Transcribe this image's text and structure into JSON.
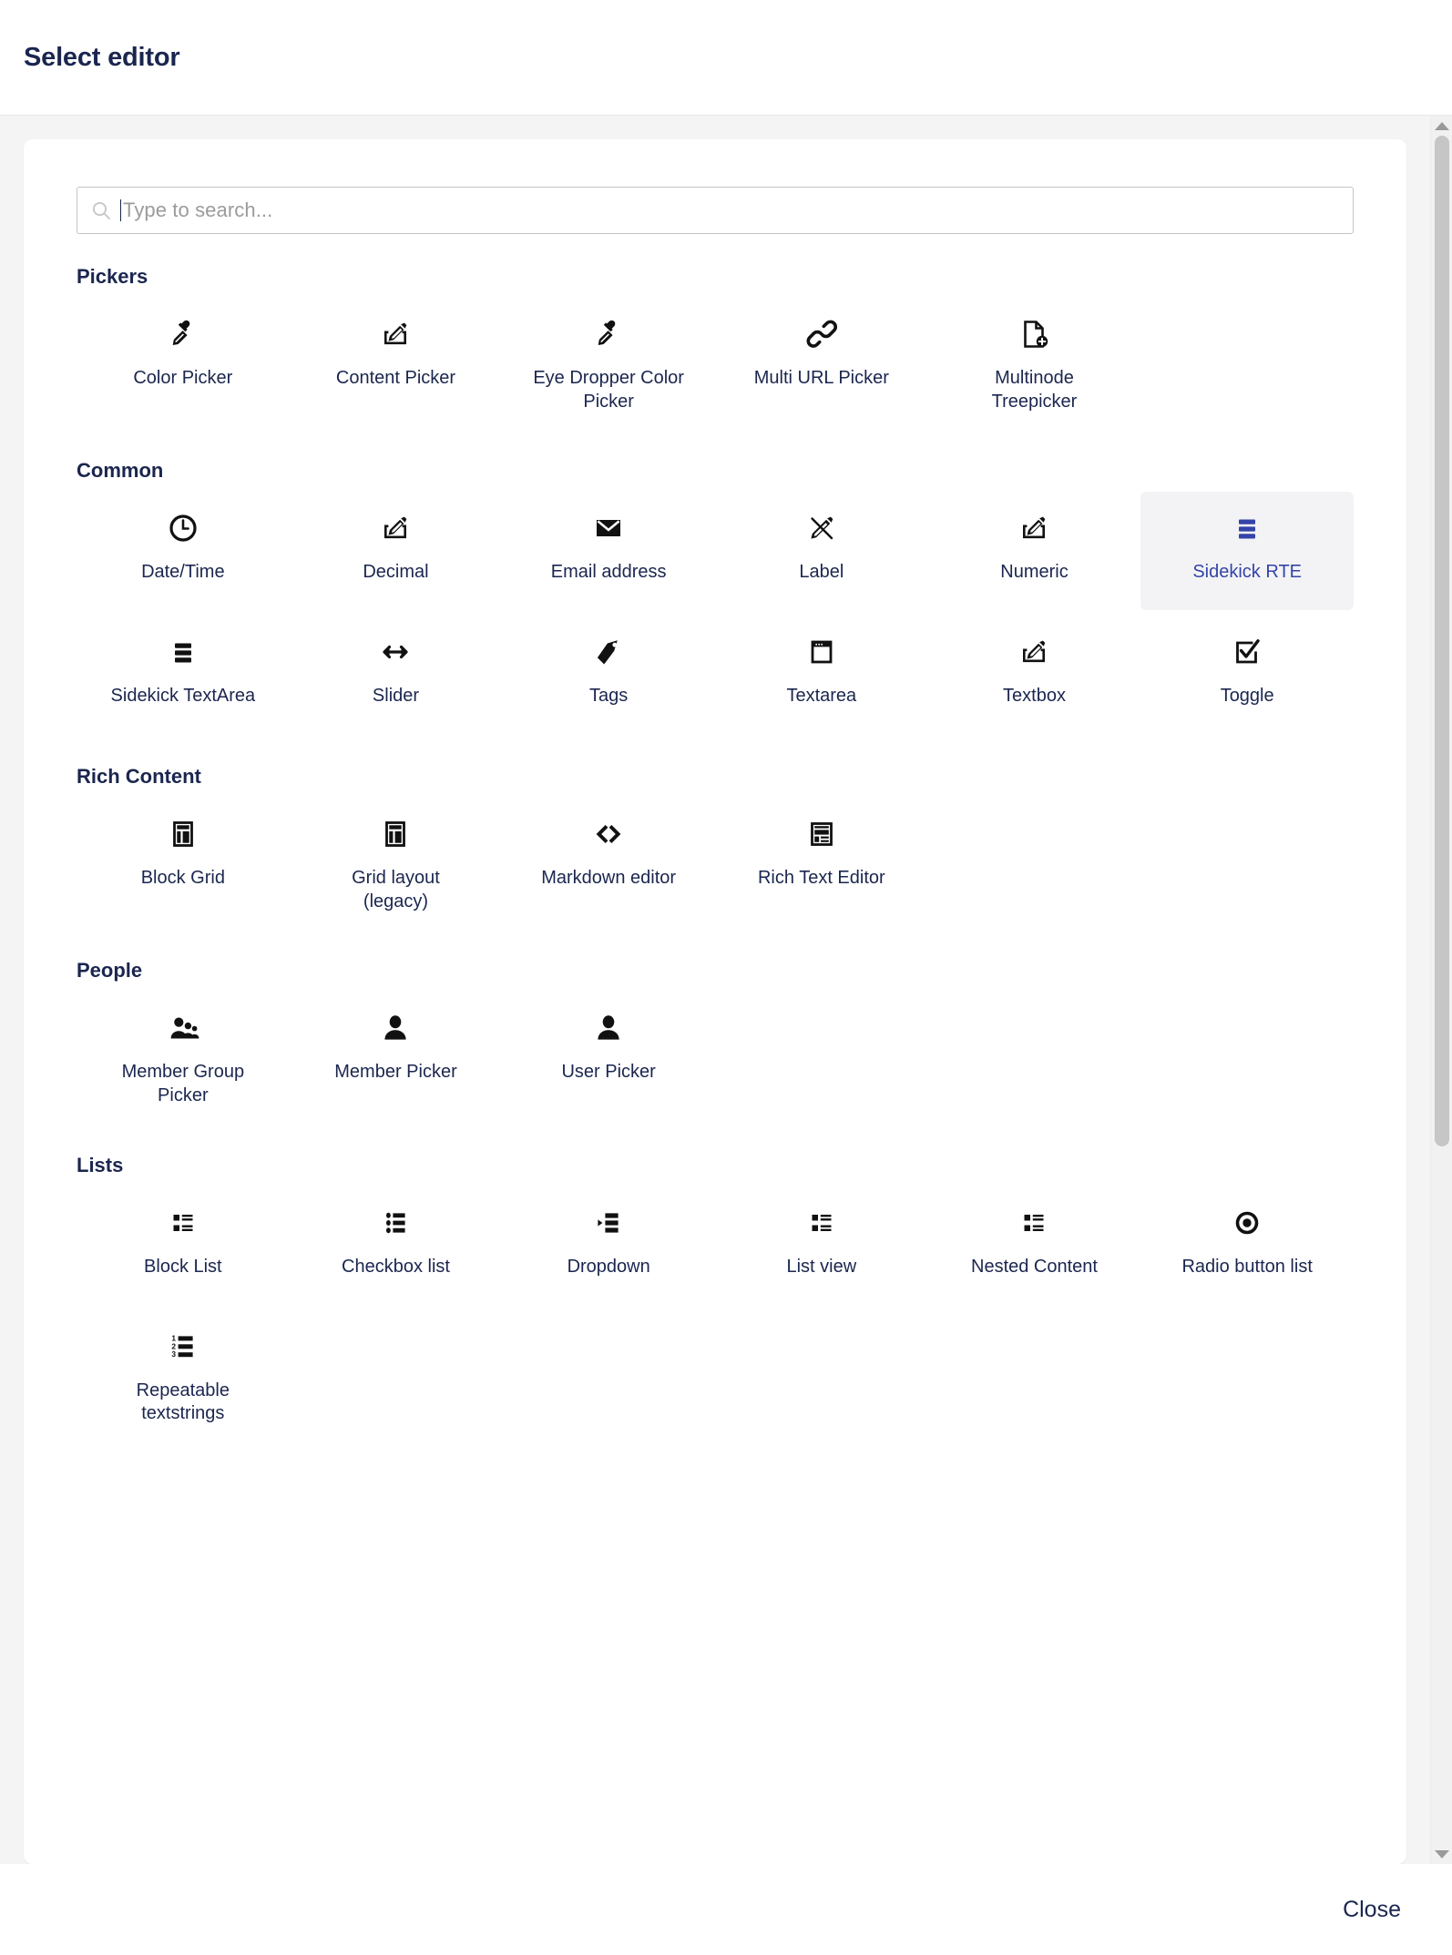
{
  "header": {
    "title": "Select editor"
  },
  "search": {
    "placeholder": "Type to search...",
    "value": "",
    "icon": "search-icon"
  },
  "footer": {
    "close_label": "Close"
  },
  "colors": {
    "accent": "#3544a8",
    "text": "#1b264f",
    "selected_bg": "#f3f3f5",
    "canvas": "#f4f4f5",
    "border": "#c4c4c7"
  },
  "selected_item": "Sidekick RTE",
  "sections": [
    {
      "title": "Pickers",
      "items": [
        {
          "label": "Color Picker",
          "icon": "eye-dropper-icon"
        },
        {
          "label": "Content Picker",
          "icon": "pencil-tray-icon"
        },
        {
          "label": "Eye Dropper Color Picker",
          "icon": "eye-dropper-icon"
        },
        {
          "label": "Multi URL Picker",
          "icon": "link-chain-icon"
        },
        {
          "label": "Multinode Treepicker",
          "icon": "document-plus-icon"
        }
      ]
    },
    {
      "title": "Common",
      "items": [
        {
          "label": "Date/Time",
          "icon": "clock-icon"
        },
        {
          "label": "Decimal",
          "icon": "pencil-tray-icon"
        },
        {
          "label": "Email address",
          "icon": "envelope-icon"
        },
        {
          "label": "Label",
          "icon": "pencil-slash-icon"
        },
        {
          "label": "Numeric",
          "icon": "pencil-tray-icon"
        },
        {
          "label": "Sidekick RTE",
          "icon": "lines-bold-icon",
          "selected": true
        },
        {
          "label": "Sidekick TextArea",
          "icon": "lines-bold-icon"
        },
        {
          "label": "Slider",
          "icon": "double-arrow-icon"
        },
        {
          "label": "Tags",
          "icon": "tag-icon"
        },
        {
          "label": "Textarea",
          "icon": "window-icon"
        },
        {
          "label": "Textbox",
          "icon": "pencil-tray-icon"
        },
        {
          "label": "Toggle",
          "icon": "check-square-icon"
        }
      ]
    },
    {
      "title": "Rich Content",
      "items": [
        {
          "label": "Block Grid",
          "icon": "layout-grid-icon"
        },
        {
          "label": "Grid layout (legacy)",
          "icon": "layout-grid-icon"
        },
        {
          "label": "Markdown editor",
          "icon": "code-brackets-icon"
        },
        {
          "label": "Rich Text Editor",
          "icon": "article-icon"
        }
      ]
    },
    {
      "title": "People",
      "items": [
        {
          "label": "Member Group Picker",
          "icon": "users-group-icon"
        },
        {
          "label": "Member Picker",
          "icon": "user-icon"
        },
        {
          "label": "User Picker",
          "icon": "user-icon"
        }
      ]
    },
    {
      "title": "Lists",
      "items": [
        {
          "label": "Block List",
          "icon": "block-list-icon"
        },
        {
          "label": "Checkbox list",
          "icon": "checkbox-list-icon"
        },
        {
          "label": "Dropdown",
          "icon": "dropdown-list-icon"
        },
        {
          "label": "List view",
          "icon": "block-list-icon"
        },
        {
          "label": "Nested Content",
          "icon": "block-list-icon"
        },
        {
          "label": "Radio button list",
          "icon": "radio-dot-icon"
        },
        {
          "label": "Repeatable textstrings",
          "icon": "numbered-list-icon"
        }
      ]
    }
  ]
}
